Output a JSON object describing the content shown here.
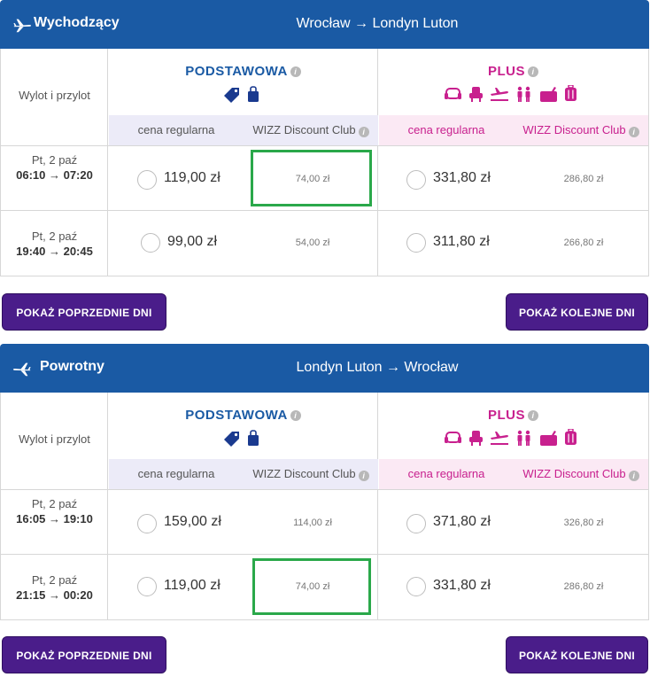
{
  "outbound": {
    "title": "Wychodzący",
    "route": "Wrocław → Londyn Luton",
    "col_label": "Wylot i przylot",
    "fares": {
      "basic": "PODSTAWOWA",
      "plus": "PLUS",
      "info": "i",
      "regular": "cena regularna",
      "club": "WIZZ Discount Club"
    },
    "rows": [
      {
        "day": "Pt, 2 paź",
        "times": "06:10 → 07:20",
        "basic": "119,00 zł",
        "basic_club": "74,00 zł",
        "plus": "331,80 zł",
        "plus_club": "286,80 zł"
      },
      {
        "day": "Pt, 2 paź",
        "times": "19:40 → 20:45",
        "basic": "99,00 zł",
        "basic_club": "54,00 zł",
        "plus": "311,80 zł",
        "plus_club": "266,80 zł"
      }
    ],
    "btn_prev": "POKAŻ POPRZEDNIE DNI",
    "btn_next": "POKAŻ KOLEJNE DNI"
  },
  "return": {
    "title": "Powrotny",
    "route": "Londyn Luton → Wrocław",
    "col_label": "Wylot i przylot",
    "fares": {
      "basic": "PODSTAWOWA",
      "plus": "PLUS",
      "info": "i",
      "regular": "cena regularna",
      "club": "WIZZ Discount Club"
    },
    "rows": [
      {
        "day": "Pt, 2 paź",
        "times": "16:05 → 19:10",
        "basic": "159,00 zł",
        "basic_club": "114,00 zł",
        "plus": "371,80 zł",
        "plus_club": "326,80 zł"
      },
      {
        "day": "Pt, 2 paź",
        "times": "21:15 → 00:20",
        "basic": "119,00 zł",
        "basic_club": "74,00 zł",
        "plus": "331,80 zł",
        "plus_club": "286,80 zł"
      }
    ],
    "btn_prev": "POKAŻ POPRZEDNIE DNI",
    "btn_next": "POKAŻ KOLEJNE DNI"
  },
  "colors": {
    "header_blue": "#1a5aa4",
    "plus_magenta": "#c8208e",
    "button_purple": "#4a1d8a",
    "highlight_green": "#2aa84a"
  },
  "icons": {
    "basic": [
      "tag-icon",
      "small-bag-icon"
    ],
    "plus": [
      "seat-icon",
      "seat-selection-icon",
      "check-in-icon",
      "priority-boarding-icon",
      "cabin-bag-icon",
      "checked-bag-icon"
    ]
  }
}
